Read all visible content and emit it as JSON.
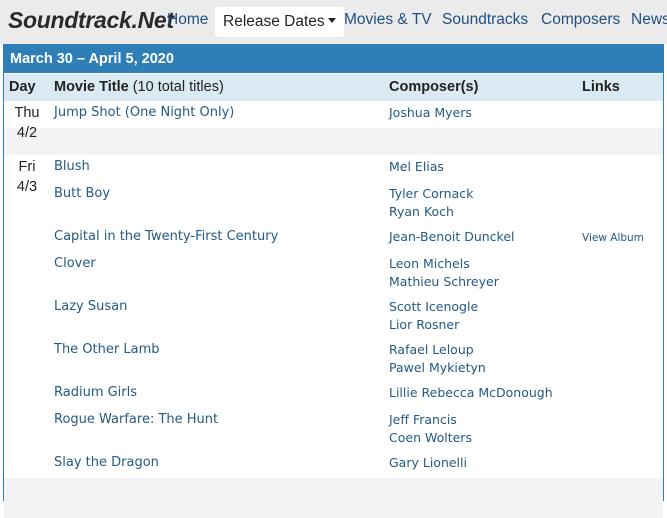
{
  "nav": {
    "logo": "Soundtrack.Net",
    "items": [
      {
        "label": "Home"
      },
      {
        "label": "Release Dates",
        "active": true
      },
      {
        "label": "Movies & TV"
      },
      {
        "label": "Soundtracks"
      },
      {
        "label": "Composers"
      },
      {
        "label": "News"
      }
    ]
  },
  "week": {
    "range": "March 30 – April 5, 2020"
  },
  "table": {
    "headers": {
      "day": "Day",
      "title": "Movie Title",
      "title_count": "(10 total titles)",
      "composers": "Composer(s)",
      "links": "Links"
    },
    "days": [
      {
        "weekday": "Thu",
        "date": "4/2",
        "movies": [
          {
            "title": "Jump Shot (One Night Only)",
            "composers": [
              "Joshua Myers"
            ],
            "link": ""
          }
        ]
      },
      {
        "weekday": "Fri",
        "date": "4/3",
        "movies": [
          {
            "title": "Blush",
            "composers": [
              "Mel Elias"
            ],
            "link": ""
          },
          {
            "title": "Butt Boy",
            "composers": [
              "Tyler Cornack",
              "Ryan Koch"
            ],
            "link": ""
          },
          {
            "title": "Capital in the Twenty-First Century",
            "composers": [
              "Jean-Benoit Dunckel"
            ],
            "link": "View Album"
          },
          {
            "title": "Clover",
            "composers": [
              "Leon Michels",
              "Mathieu Schreyer"
            ],
            "link": ""
          },
          {
            "title": "Lazy Susan",
            "composers": [
              "Scott Icenogle",
              "Lior Rosner"
            ],
            "link": ""
          },
          {
            "title": "The Other Lamb",
            "composers": [
              "Rafael Leloup",
              "Pawel Mykietyn"
            ],
            "link": ""
          },
          {
            "title": "Radium Girls",
            "composers": [
              "Lillie Rebecca McDonough"
            ],
            "link": ""
          },
          {
            "title": "Rogue Warfare: The Hunt",
            "composers": [
              "Jeff Francis",
              "Coen Wolters"
            ],
            "link": ""
          },
          {
            "title": "Slay the Dragon",
            "composers": [
              "Gary Lionelli"
            ],
            "link": ""
          }
        ]
      }
    ]
  }
}
